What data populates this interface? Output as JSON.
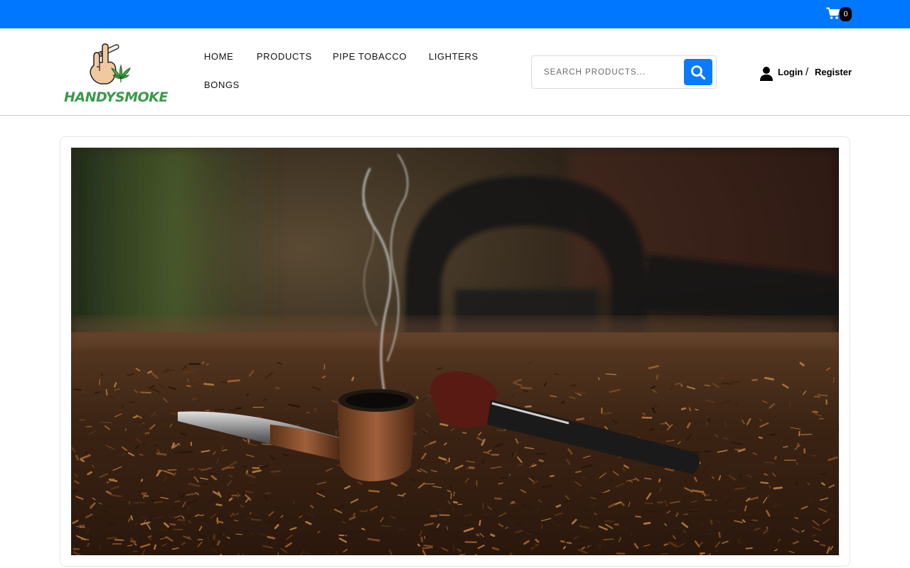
{
  "topbar": {
    "cart_count": "0"
  },
  "brand": {
    "name": "HANDYSMOKE"
  },
  "nav": {
    "items": [
      "HOME",
      "PRODUCTS",
      "PIPE TOBACCO",
      "LIGHTERS",
      "BONGS"
    ]
  },
  "search": {
    "placeholder": "SEARCH PRODUCTS..."
  },
  "account": {
    "login_label": "Login",
    "separator": "/",
    "register_label": "Register"
  },
  "colors": {
    "accent": "#0077ff",
    "brand_green": "#3a9a4a"
  },
  "icons": {
    "cart": "cart-icon",
    "search": "search-icon",
    "user": "user-icon"
  }
}
